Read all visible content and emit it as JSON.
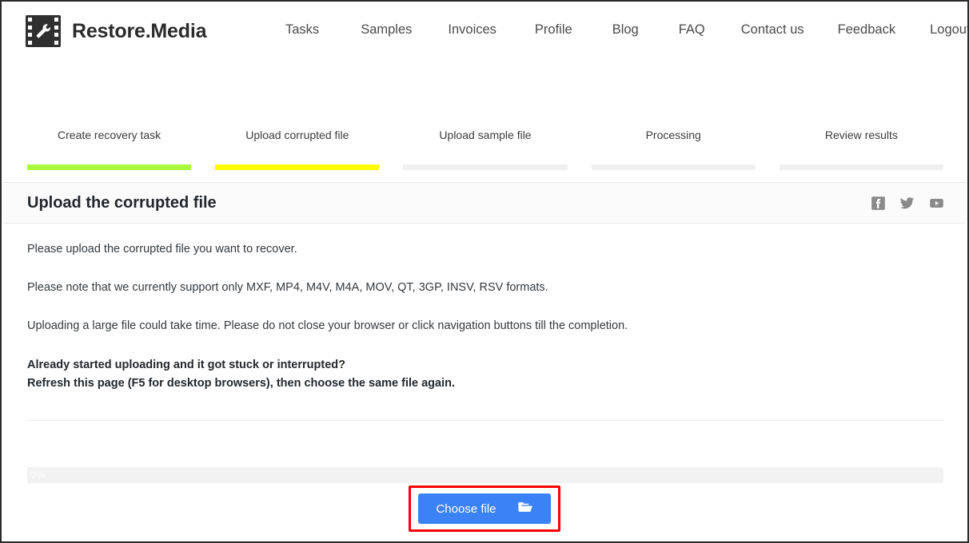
{
  "brand": {
    "name": "Restore.Media",
    "logo_icon": "film-wrench-logo-icon"
  },
  "nav": {
    "items": [
      {
        "label": "Tasks"
      },
      {
        "label": "Samples"
      },
      {
        "label": "Invoices"
      },
      {
        "label": "Profile"
      },
      {
        "label": "Blog"
      },
      {
        "label": "FAQ"
      },
      {
        "label": "Contact us"
      },
      {
        "label": "Feedback"
      },
      {
        "label": "Logout"
      }
    ]
  },
  "steps": [
    {
      "label": "Create recovery task",
      "state": "complete",
      "color": "#a8f83c"
    },
    {
      "label": "Upload corrupted file",
      "state": "current",
      "color": "#ffff00"
    },
    {
      "label": "Upload sample file",
      "state": "pending",
      "color": "#f0f0f0"
    },
    {
      "label": "Processing",
      "state": "pending",
      "color": "#f0f0f0"
    },
    {
      "label": "Review results",
      "state": "pending",
      "color": "#f0f0f0"
    }
  ],
  "panel": {
    "title": "Upload the corrupted file",
    "socials": [
      {
        "name": "facebook-icon"
      },
      {
        "name": "twitter-icon"
      },
      {
        "name": "youtube-icon"
      }
    ]
  },
  "body": {
    "paragraph_1": "Please upload the corrupted file you want to recover.",
    "paragraph_2": "Please note that we currently support only MXF, MP4, M4V, M4A, MOV, QT, 3GP, INSV, RSV formats.",
    "paragraph_3": "Uploading a large file could take time. Please do not close your browser or click navigation buttons till the completion.",
    "bold_line_1": "Already started uploading and it got stuck or interrupted?",
    "bold_line_2": "Refresh this page (F5 for desktop browsers), then choose the same file again."
  },
  "upload": {
    "progress_label": "0%",
    "progress_value": 0,
    "choose_file_label": "Choose file",
    "folder_icon": "open-folder-icon",
    "highlight_color": "#ff0000",
    "button_color": "#3b82f6"
  }
}
